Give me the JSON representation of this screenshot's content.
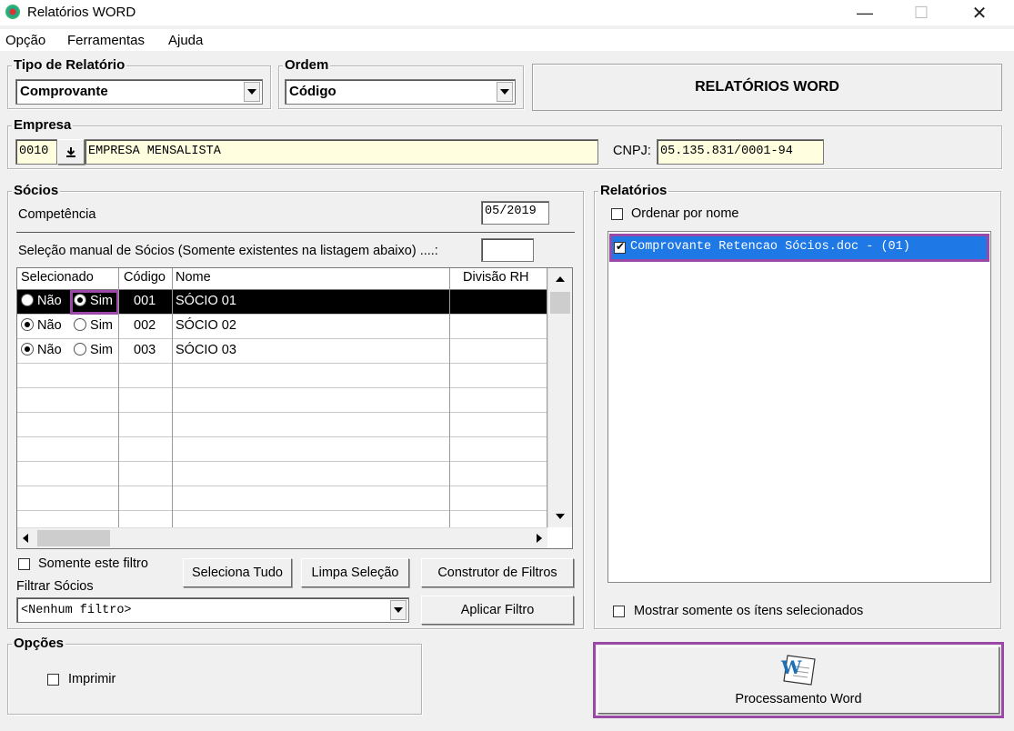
{
  "window": {
    "title": "Relatórios WORD",
    "minimize": "—",
    "maximize": "☐",
    "close": "✕"
  },
  "menu": [
    "Opção",
    "Ferramentas",
    "Ajuda"
  ],
  "tipo_relatorio": {
    "title": "Tipo de Relatório",
    "value": "Comprovante"
  },
  "ordem": {
    "title": "Ordem",
    "value": "Código"
  },
  "banner": "RELATÓRIOS WORD",
  "empresa": {
    "title": "Empresa",
    "code": "0010",
    "name": "EMPRESA MENSALISTA",
    "cnpj_label": "CNPJ:",
    "cnpj": "05.135.831/0001-94"
  },
  "socios": {
    "title": "Sócios",
    "competencia_label": "Competência",
    "competencia": "05/2019",
    "manual_label": "Seleção manual de Sócios (Somente existentes na listagem abaixo) ....:",
    "manual_value": "",
    "columns": [
      "Selecionado",
      "Código",
      "Nome",
      "Divisão RH"
    ],
    "rows": [
      {
        "nao": "Não",
        "sim": "Sim",
        "selected": "sim",
        "codigo": "001",
        "nome": "SÓCIO 01",
        "divisao": ""
      },
      {
        "nao": "Não",
        "sim": "Sim",
        "selected": "nao",
        "codigo": "002",
        "nome": "SÓCIO 02",
        "divisao": ""
      },
      {
        "nao": "Não",
        "sim": "Sim",
        "selected": "nao",
        "codigo": "003",
        "nome": "SÓCIO 03",
        "divisao": ""
      }
    ],
    "somente_filtro": "Somente este filtro",
    "seleciona_tudo": "Seleciona Tudo",
    "limpa_selecao": "Limpa Seleção",
    "construtor": "Construtor de Filtros",
    "filtrar_label": "Filtrar Sócios",
    "filtro_value": "<Nenhum filtro>",
    "aplicar": "Aplicar Filtro"
  },
  "relatorios": {
    "title": "Relatórios",
    "ordenar": "Ordenar por nome",
    "items": [
      {
        "label": "Comprovante Retencao Sócios.doc - (01)",
        "checked": true
      }
    ],
    "mostrar": "Mostrar somente os ítens selecionados"
  },
  "opcoes": {
    "title": "Opções",
    "imprimir": "Imprimir"
  },
  "processamento": {
    "label": "Processamento Word",
    "icon": "word-icon"
  },
  "colors": {
    "purple": "#9a4aa6",
    "selection": "#1e78e6"
  }
}
